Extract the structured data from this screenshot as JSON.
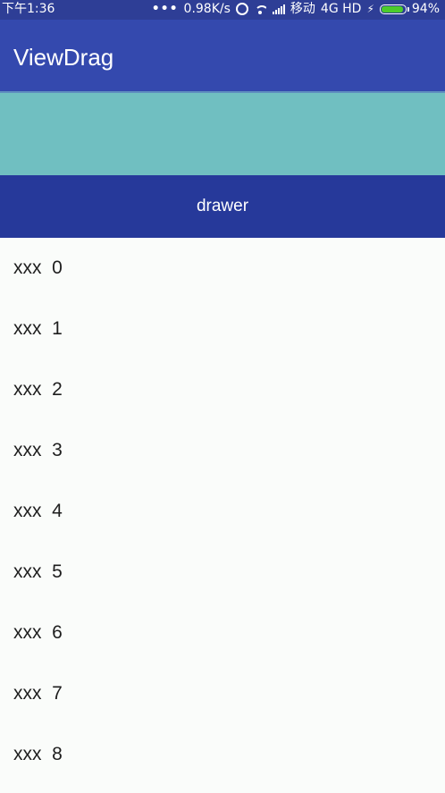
{
  "status_bar": {
    "time": "下午1:36",
    "dots": "•••",
    "network_speed": "0.98K/s",
    "carrier": "移动",
    "network_type": "4G HD",
    "battery_percent": "94%",
    "battery_level": 0.94,
    "battery_color": "#4ccc2c"
  },
  "app_bar": {
    "title": "ViewDrag",
    "color": "#3449ae"
  },
  "drag_area": {
    "color": "#70bfc1"
  },
  "drawer": {
    "label": "drawer",
    "color": "#26399a"
  },
  "list": {
    "items": [
      {
        "label": "xxx  0"
      },
      {
        "label": "xxx  1"
      },
      {
        "label": "xxx  2"
      },
      {
        "label": "xxx  3"
      },
      {
        "label": "xxx  4"
      },
      {
        "label": "xxx  5"
      },
      {
        "label": "xxx  6"
      },
      {
        "label": "xxx  7"
      },
      {
        "label": "xxx  8"
      }
    ]
  }
}
